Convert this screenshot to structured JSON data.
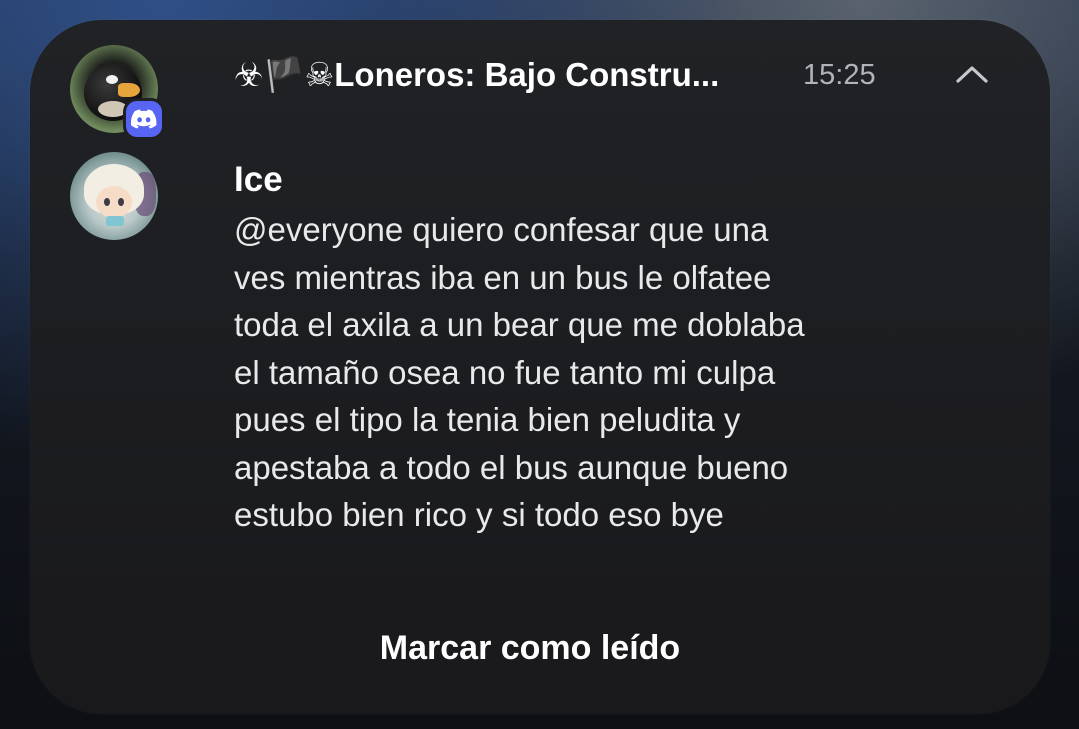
{
  "notification": {
    "app_icon": "discord-icon",
    "server_avatar": "angry-bird-bomb-avatar",
    "user_avatar": "anime-character-avatar",
    "title": "☣🏴☠Loneros: Bajo Constru...",
    "time": "15:25",
    "collapse_icon": "chevron-up-icon",
    "sender": "Ice",
    "message_lines": [
      "@everyone quiero confesar que una",
      "ves mientras iba en un bus le olfatee",
      "toda el axila a un bear que me doblaba",
      "el tamaño osea no fue tanto mi culpa",
      "pues el tipo la tenia bien peludita y",
      "apestaba a todo el bus aunque bueno",
      "estubo bien rico y si todo eso bye"
    ],
    "action_label": "Marcar como leído"
  },
  "colors": {
    "card_background": "#1e1f22",
    "discord_blurple": "#5865f2",
    "time_text": "#b0b3b8"
  }
}
